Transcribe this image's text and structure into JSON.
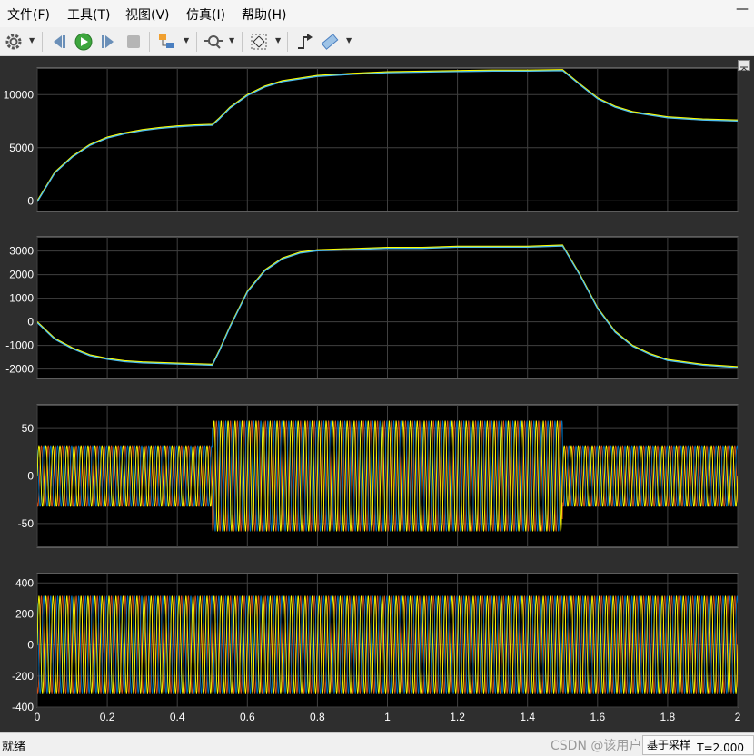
{
  "menu": [
    {
      "id": "file",
      "label": "文件(F)"
    },
    {
      "id": "tools",
      "label": "工具(T)"
    },
    {
      "id": "view",
      "label": "视图(V)"
    },
    {
      "id": "simulation",
      "label": "仿真(I)"
    },
    {
      "id": "help",
      "label": "帮助(H)"
    }
  ],
  "window_buttons": {
    "minimize": "—"
  },
  "status": {
    "text": "就绪",
    "watermark": "CSDN @该用户已躺平@—",
    "sample_mode": "基于采样",
    "time": "T=2.000"
  },
  "colors": {
    "background": "#000000",
    "panel": "#2e2e2e",
    "grid": "#404040",
    "axis_text": "#ffffff",
    "series": [
      "#ffff00",
      "#0072bd",
      "#d95319",
      "#4dbeee"
    ]
  },
  "chart_data": [
    {
      "type": "line",
      "xlim": [
        0,
        2
      ],
      "ylim": [
        -1000,
        12500
      ],
      "yticks": [
        0,
        5000,
        10000
      ],
      "x_ticks": [],
      "grid": true,
      "series": [
        {
          "points": [
            [
              0,
              0
            ],
            [
              0.05,
              2700
            ],
            [
              0.1,
              4200
            ],
            [
              0.15,
              5300
            ],
            [
              0.2,
              6000
            ],
            [
              0.25,
              6400
            ],
            [
              0.3,
              6700
            ],
            [
              0.35,
              6900
            ],
            [
              0.4,
              7050
            ],
            [
              0.45,
              7150
            ],
            [
              0.5,
              7200
            ],
            [
              0.52,
              7800
            ],
            [
              0.55,
              8800
            ],
            [
              0.6,
              10000
            ],
            [
              0.65,
              10800
            ],
            [
              0.7,
              11300
            ],
            [
              0.8,
              11800
            ],
            [
              0.9,
              12000
            ],
            [
              1.0,
              12150
            ],
            [
              1.1,
              12200
            ],
            [
              1.2,
              12250
            ],
            [
              1.3,
              12300
            ],
            [
              1.4,
              12300
            ],
            [
              1.5,
              12350
            ],
            [
              1.55,
              11000
            ],
            [
              1.6,
              9700
            ],
            [
              1.65,
              8900
            ],
            [
              1.7,
              8400
            ],
            [
              1.8,
              7900
            ],
            [
              1.9,
              7700
            ],
            [
              2.0,
              7600
            ]
          ]
        }
      ]
    },
    {
      "type": "line",
      "xlim": [
        0,
        2
      ],
      "ylim": [
        -2400,
        3600
      ],
      "yticks": [
        -2000,
        -1000,
        0,
        1000,
        2000,
        3000
      ],
      "x_ticks": [],
      "grid": true,
      "series": [
        {
          "points": [
            [
              0,
              0
            ],
            [
              0.05,
              -700
            ],
            [
              0.1,
              -1100
            ],
            [
              0.15,
              -1400
            ],
            [
              0.2,
              -1550
            ],
            [
              0.25,
              -1650
            ],
            [
              0.3,
              -1700
            ],
            [
              0.4,
              -1750
            ],
            [
              0.5,
              -1800
            ],
            [
              0.52,
              -1200
            ],
            [
              0.55,
              -200
            ],
            [
              0.6,
              1300
            ],
            [
              0.65,
              2200
            ],
            [
              0.7,
              2700
            ],
            [
              0.75,
              2950
            ],
            [
              0.8,
              3050
            ],
            [
              0.9,
              3100
            ],
            [
              1.0,
              3150
            ],
            [
              1.1,
              3150
            ],
            [
              1.2,
              3200
            ],
            [
              1.3,
              3200
            ],
            [
              1.4,
              3200
            ],
            [
              1.5,
              3250
            ],
            [
              1.55,
              2000
            ],
            [
              1.6,
              600
            ],
            [
              1.65,
              -400
            ],
            [
              1.7,
              -1000
            ],
            [
              1.75,
              -1350
            ],
            [
              1.8,
              -1600
            ],
            [
              1.9,
              -1800
            ],
            [
              2.0,
              -1900
            ]
          ]
        }
      ]
    },
    {
      "type": "line",
      "xlim": [
        0,
        2
      ],
      "ylim": [
        -75,
        75
      ],
      "yticks": [
        -50,
        0,
        50
      ],
      "x_ticks": [],
      "grid": true,
      "series": [
        {
          "segments": [
            {
              "x": [
                0,
                0.5
              ],
              "amplitude": 32
            },
            {
              "x": [
                0.5,
                1.5
              ],
              "amplitude": 58
            },
            {
              "x": [
                1.5,
                2
              ],
              "amplitude": 32
            }
          ],
          "phase": 0
        },
        {
          "segments": [
            {
              "x": [
                0,
                0.5
              ],
              "amplitude": 32
            },
            {
              "x": [
                0.5,
                1.5
              ],
              "amplitude": 58
            },
            {
              "x": [
                1.5,
                2
              ],
              "amplitude": 32
            }
          ],
          "phase": 2.094
        },
        {
          "segments": [
            {
              "x": [
                0,
                0.5
              ],
              "amplitude": 32
            },
            {
              "x": [
                0.5,
                1.5
              ],
              "amplitude": 58
            },
            {
              "x": [
                1.5,
                2
              ],
              "amplitude": 32
            }
          ],
          "phase": 4.189
        }
      ]
    },
    {
      "type": "line",
      "xlim": [
        0,
        2
      ],
      "ylim": [
        -400,
        460
      ],
      "yticks": [
        -400,
        -200,
        0,
        200,
        400
      ],
      "x_ticks": [
        0,
        0.2,
        0.4,
        0.6,
        0.8,
        1,
        1.2,
        1.4,
        1.6,
        1.8,
        2
      ],
      "grid": true,
      "series": [
        {
          "segments": [
            {
              "x": [
                0,
                2
              ],
              "amplitude": 315
            }
          ],
          "phase": 0
        },
        {
          "segments": [
            {
              "x": [
                0,
                2
              ],
              "amplitude": 315
            }
          ],
          "phase": 2.094
        },
        {
          "segments": [
            {
              "x": [
                0,
                2
              ],
              "amplitude": 315
            }
          ],
          "phase": 4.189
        }
      ]
    }
  ]
}
